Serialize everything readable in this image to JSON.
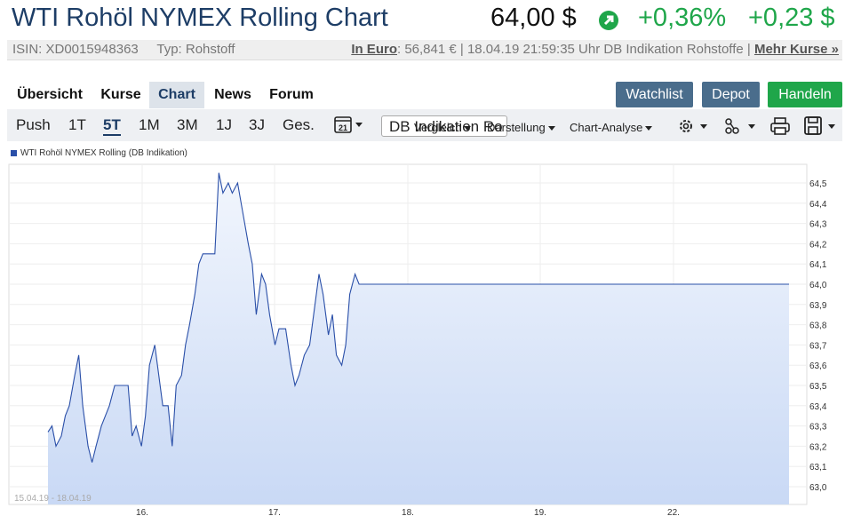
{
  "header": {
    "title": "WTI Rohöl NYMEX Rolling Chart",
    "price": "64,00 $",
    "change_pct": "+0,36%",
    "change_abs": "+0,23 $",
    "accent": "#1fa64a"
  },
  "infobar": {
    "isin": "ISIN: XD0015948363",
    "type": "Typ: Rohstoff",
    "euro_label": "In Euro",
    "euro_rest": ": 56,841 € | 18.04.19 21:59:35 Uhr DB Indikation Rohstoffe |",
    "more": "Mehr Kurse »"
  },
  "tabs": [
    "Übersicht",
    "Kurse",
    "Chart",
    "News",
    "Forum"
  ],
  "buttons": {
    "watchlist": "Watchlist",
    "depot": "Depot",
    "handeln": "Handeln"
  },
  "toolbar": {
    "ranges": [
      "Push",
      "1T",
      "5T",
      "1M",
      "3M",
      "1J",
      "3J",
      "Ges."
    ],
    "calendar_day": "21",
    "source": "DB Indikation Ro",
    "compare": "Vergleich",
    "darstellung": "Darstellung",
    "analyse": "Chart-Analyse"
  },
  "chart_data": {
    "type": "area",
    "legend": "WTI Rohöl NYMEX Rolling (DB Indikation)",
    "date_range": "15.04.19 - 18.04.19",
    "x_labels": [
      "16.",
      "17.",
      "18.",
      "19.",
      "22."
    ],
    "y_ticks": [
      "63,0",
      "63,1",
      "63,2",
      "63,3",
      "63,4",
      "63,5",
      "63,6",
      "63,7",
      "63,8",
      "63,9",
      "64,0",
      "64,1",
      "64,2",
      "64,3",
      "64,4",
      "64,5"
    ],
    "ylim": [
      63.0,
      64.5
    ],
    "grid": true,
    "line_color": "#2a4fa8",
    "series": [
      {
        "x": 0.0,
        "y": 63.27
      },
      {
        "x": 0.03,
        "y": 63.3
      },
      {
        "x": 0.06,
        "y": 63.2
      },
      {
        "x": 0.1,
        "y": 63.25
      },
      {
        "x": 0.13,
        "y": 63.35
      },
      {
        "x": 0.16,
        "y": 63.4
      },
      {
        "x": 0.2,
        "y": 63.55
      },
      {
        "x": 0.23,
        "y": 63.65
      },
      {
        "x": 0.26,
        "y": 63.4
      },
      {
        "x": 0.3,
        "y": 63.2
      },
      {
        "x": 0.33,
        "y": 63.12
      },
      {
        "x": 0.36,
        "y": 63.2
      },
      {
        "x": 0.4,
        "y": 63.3
      },
      {
        "x": 0.43,
        "y": 63.35
      },
      {
        "x": 0.46,
        "y": 63.4
      },
      {
        "x": 0.5,
        "y": 63.5
      },
      {
        "x": 0.55,
        "y": 63.5
      },
      {
        "x": 0.6,
        "y": 63.5
      },
      {
        "x": 0.63,
        "y": 63.25
      },
      {
        "x": 0.66,
        "y": 63.3
      },
      {
        "x": 0.7,
        "y": 63.2
      },
      {
        "x": 0.73,
        "y": 63.35
      },
      {
        "x": 0.76,
        "y": 63.6
      },
      {
        "x": 0.8,
        "y": 63.7
      },
      {
        "x": 0.83,
        "y": 63.55
      },
      {
        "x": 0.86,
        "y": 63.4
      },
      {
        "x": 0.9,
        "y": 63.4
      },
      {
        "x": 0.93,
        "y": 63.2
      },
      {
        "x": 0.96,
        "y": 63.5
      },
      {
        "x": 1.0,
        "y": 63.55
      },
      {
        "x": 1.03,
        "y": 63.7
      },
      {
        "x": 1.06,
        "y": 63.8
      },
      {
        "x": 1.1,
        "y": 63.95
      },
      {
        "x": 1.13,
        "y": 64.1
      },
      {
        "x": 1.16,
        "y": 64.15
      },
      {
        "x": 1.25,
        "y": 64.15
      },
      {
        "x": 1.28,
        "y": 64.55
      },
      {
        "x": 1.31,
        "y": 64.45
      },
      {
        "x": 1.35,
        "y": 64.5
      },
      {
        "x": 1.38,
        "y": 64.45
      },
      {
        "x": 1.42,
        "y": 64.5
      },
      {
        "x": 1.46,
        "y": 64.35
      },
      {
        "x": 1.5,
        "y": 64.2
      },
      {
        "x": 1.53,
        "y": 64.1
      },
      {
        "x": 1.56,
        "y": 63.85
      },
      {
        "x": 1.6,
        "y": 64.05
      },
      {
        "x": 1.63,
        "y": 64.0
      },
      {
        "x": 1.66,
        "y": 63.85
      },
      {
        "x": 1.7,
        "y": 63.7
      },
      {
        "x": 1.73,
        "y": 63.78
      },
      {
        "x": 1.78,
        "y": 63.78
      },
      {
        "x": 1.82,
        "y": 63.6
      },
      {
        "x": 1.85,
        "y": 63.5
      },
      {
        "x": 1.88,
        "y": 63.55
      },
      {
        "x": 1.92,
        "y": 63.65
      },
      {
        "x": 1.96,
        "y": 63.7
      },
      {
        "x": 2.0,
        "y": 63.9
      },
      {
        "x": 2.03,
        "y": 64.05
      },
      {
        "x": 2.06,
        "y": 63.95
      },
      {
        "x": 2.1,
        "y": 63.75
      },
      {
        "x": 2.13,
        "y": 63.85
      },
      {
        "x": 2.16,
        "y": 63.65
      },
      {
        "x": 2.2,
        "y": 63.6
      },
      {
        "x": 2.23,
        "y": 63.7
      },
      {
        "x": 2.26,
        "y": 63.95
      },
      {
        "x": 2.3,
        "y": 64.05
      },
      {
        "x": 2.33,
        "y": 64.0
      },
      {
        "x": 2.4,
        "y": 64.0
      },
      {
        "x": 2.6,
        "y": 64.0
      },
      {
        "x": 2.8,
        "y": 64.0
      },
      {
        "x": 3.0,
        "y": 64.0
      },
      {
        "x": 3.2,
        "y": 64.0
      },
      {
        "x": 3.4,
        "y": 64.0
      },
      {
        "x": 3.6,
        "y": 64.0
      },
      {
        "x": 3.8,
        "y": 64.0
      },
      {
        "x": 4.0,
        "y": 64.0
      },
      {
        "x": 4.2,
        "y": 64.0
      },
      {
        "x": 4.4,
        "y": 64.0
      },
      {
        "x": 4.6,
        "y": 64.0
      },
      {
        "x": 4.8,
        "y": 64.0
      },
      {
        "x": 5.0,
        "y": 64.0
      },
      {
        "x": 5.2,
        "y": 64.0
      },
      {
        "x": 5.4,
        "y": 64.0
      },
      {
        "x": 5.55,
        "y": 64.0
      }
    ]
  }
}
